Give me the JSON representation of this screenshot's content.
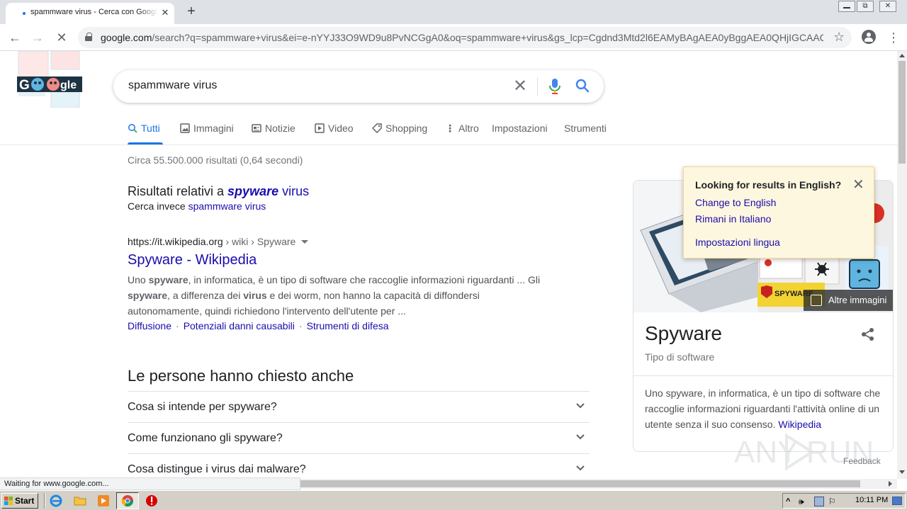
{
  "browser": {
    "tab_title": "spammware virus - Cerca con Google",
    "tab_close": "✕",
    "new_tab": "+",
    "window_buttons": [
      "▭",
      "⧉",
      "✕"
    ],
    "url_host": "google.com",
    "url_rest": "/search?q=spammware+virus&ei=e-nYYJ33O9WD9u8PvNCGgA0&oq=spammware+virus&gs_lcp=Cgdnd3Mtd2l6EAMyBAgAEA0yBggAEA0QHjIGCAAQD...",
    "back": "←",
    "forward": "→",
    "reload": "✕",
    "bookmark": "☆",
    "menu": "⋮",
    "status": "Waiting for www.google.com..."
  },
  "search": {
    "query": "spammware virus"
  },
  "nav_tabs": {
    "all": "Tutti",
    "images": "Immagini",
    "news": "Notizie",
    "video": "Video",
    "shopping": "Shopping",
    "more": "Altro",
    "settings": "Impostazioni",
    "tools": "Strumenti"
  },
  "results": {
    "stats": "Circa 55.500.000 risultati (0,64 secondi)",
    "spell_prefix": "Risultati relativi a ",
    "spell_correct_bold": "spyware",
    "spell_correct_rest": " virus",
    "spell_alt_prefix": "Cerca invece ",
    "spell_alt_link": "spammware virus",
    "first": {
      "cite_host": "https://it.wikipedia.org",
      "cite_path": " › wiki › Spyware",
      "title": "Spyware - Wikipedia",
      "s1": "Uno ",
      "b1": "spyware",
      "s2": ", in informatica, è un tipo di software che raccoglie informazioni riguardanti ... Gli ",
      "b2": "spyware",
      "s3": ", a differenza dei ",
      "b3": "virus",
      "s4": " e dei worm, non hanno la capacità di diffondersi autonomamente, quindi richiedono l'intervento dell'utente per ...",
      "links": [
        "Diffusione",
        "Potenziali danni causabili",
        "Strumenti di difesa"
      ],
      "link_sep": "·"
    }
  },
  "paa": {
    "title": "Le persone hanno chiesto anche",
    "questions": [
      "Cosa si intende per spyware?",
      "Come funzionano gli spyware?",
      "Cosa distingue i virus dai malware?"
    ]
  },
  "knowledge_panel": {
    "title": "Spyware",
    "subtitle": "Tipo di software",
    "description": "Uno spyware, in informatica, è un tipo di software che raccoglie informazioni riguardanti l'attività online di un utente senza il suo consenso.",
    "source": "Wikipedia",
    "more_images": "Altre immagini",
    "image_label": "SPYWARE",
    "feedback": "Feedback"
  },
  "language_popup": {
    "title": "Looking for results in English?",
    "change": "Change to English",
    "stay": "Rimani in Italiano",
    "settings": "Impostazioni lingua"
  },
  "watermark": {
    "text": "ANY RUN"
  },
  "taskbar": {
    "start": "Start",
    "clock": "10:11 PM"
  },
  "colors": {
    "link": "#1a0dab",
    "accent": "#1a73e8",
    "popup_bg": "#fef7e0"
  }
}
